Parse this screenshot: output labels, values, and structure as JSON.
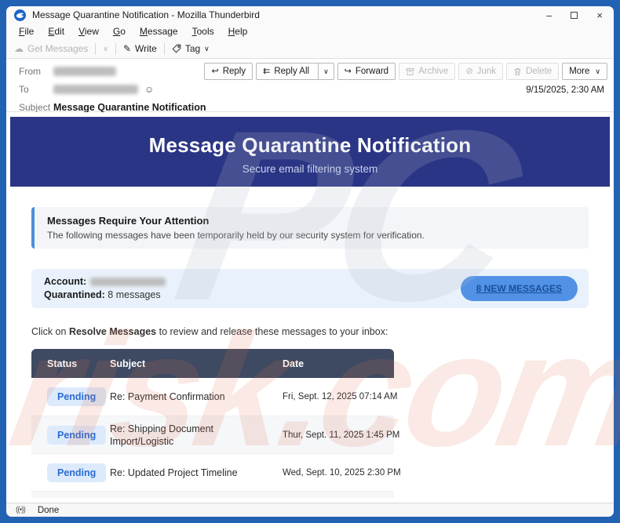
{
  "window": {
    "title": "Message Quarantine Notification - Mozilla Thunderbird",
    "controls": {
      "minimize": "–",
      "close": "×"
    }
  },
  "menu": {
    "items": [
      "File",
      "Edit",
      "View",
      "Go",
      "Message",
      "Tools",
      "Help"
    ]
  },
  "toolbar": {
    "get_messages_label": "Get Messages",
    "write_label": "Write",
    "tag_label": "Tag"
  },
  "glyphs": {
    "cloud": "☁",
    "pencil": "✎",
    "chevron_down": "∨",
    "reply": "↩",
    "reply_all": "⇇",
    "forward": "↪",
    "junk": "⊘",
    "contact": "☺",
    "broadcast": "((•))"
  },
  "message_header": {
    "from_label": "From",
    "to_label": "To",
    "subject_label": "Subject",
    "subject_value": "Message Quarantine Notification",
    "date": "9/15/2025, 2:30 AM",
    "actions": {
      "reply": "Reply",
      "reply_all": "Reply All",
      "forward": "Forward",
      "archive": "Archive",
      "junk": "Junk",
      "delete": "Delete",
      "more": "More"
    }
  },
  "email": {
    "banner": {
      "title": "Message Quarantine Notification",
      "subtitle": "Secure email filtering system"
    },
    "alert": {
      "title": "Messages Require Your Attention",
      "text": "The following messages have been temporarily held by our security system for verification."
    },
    "account": {
      "account_label": "Account:",
      "quarantined_label": "Quarantined:",
      "quarantined_value": "8 messages",
      "button_label": "8 NEW MESSAGES"
    },
    "instruction": {
      "prefix": "Click on ",
      "bold": "Resolve Messages",
      "suffix": " to review and release these messages to your inbox:"
    },
    "table": {
      "headers": [
        "Status",
        "Subject",
        "Date"
      ],
      "rows": [
        {
          "status": "Pending",
          "subject": "Re: Payment Confirmation",
          "date": "Fri, Sept. 12, 2025 07:14 AM"
        },
        {
          "status": "Pending",
          "subject": "Re: Shipping Document Import/Logistic",
          "date": "Thur, Sept. 11, 2025 1:45 PM"
        },
        {
          "status": "Pending",
          "subject": "Re: Updated Project Timeline",
          "date": "Wed, Sept. 10, 2025 2:30 PM"
        }
      ]
    }
  },
  "statusbar": {
    "text": "Done"
  },
  "watermark": {
    "part1": "PC",
    "part2": "risk.com"
  },
  "colors": {
    "frame_blue": "#2262b2",
    "banner_bg": "#2a3585",
    "table_header_bg": "#3e4a62",
    "badge_bg": "#dceafc",
    "badge_text": "#2b6cd4",
    "pill_bg": "#5292e6",
    "pill_text": "#174f9c",
    "alert_border": "#4a90d9",
    "alert_bg": "#f3f5f8",
    "account_bg": "#e9f2fc"
  }
}
